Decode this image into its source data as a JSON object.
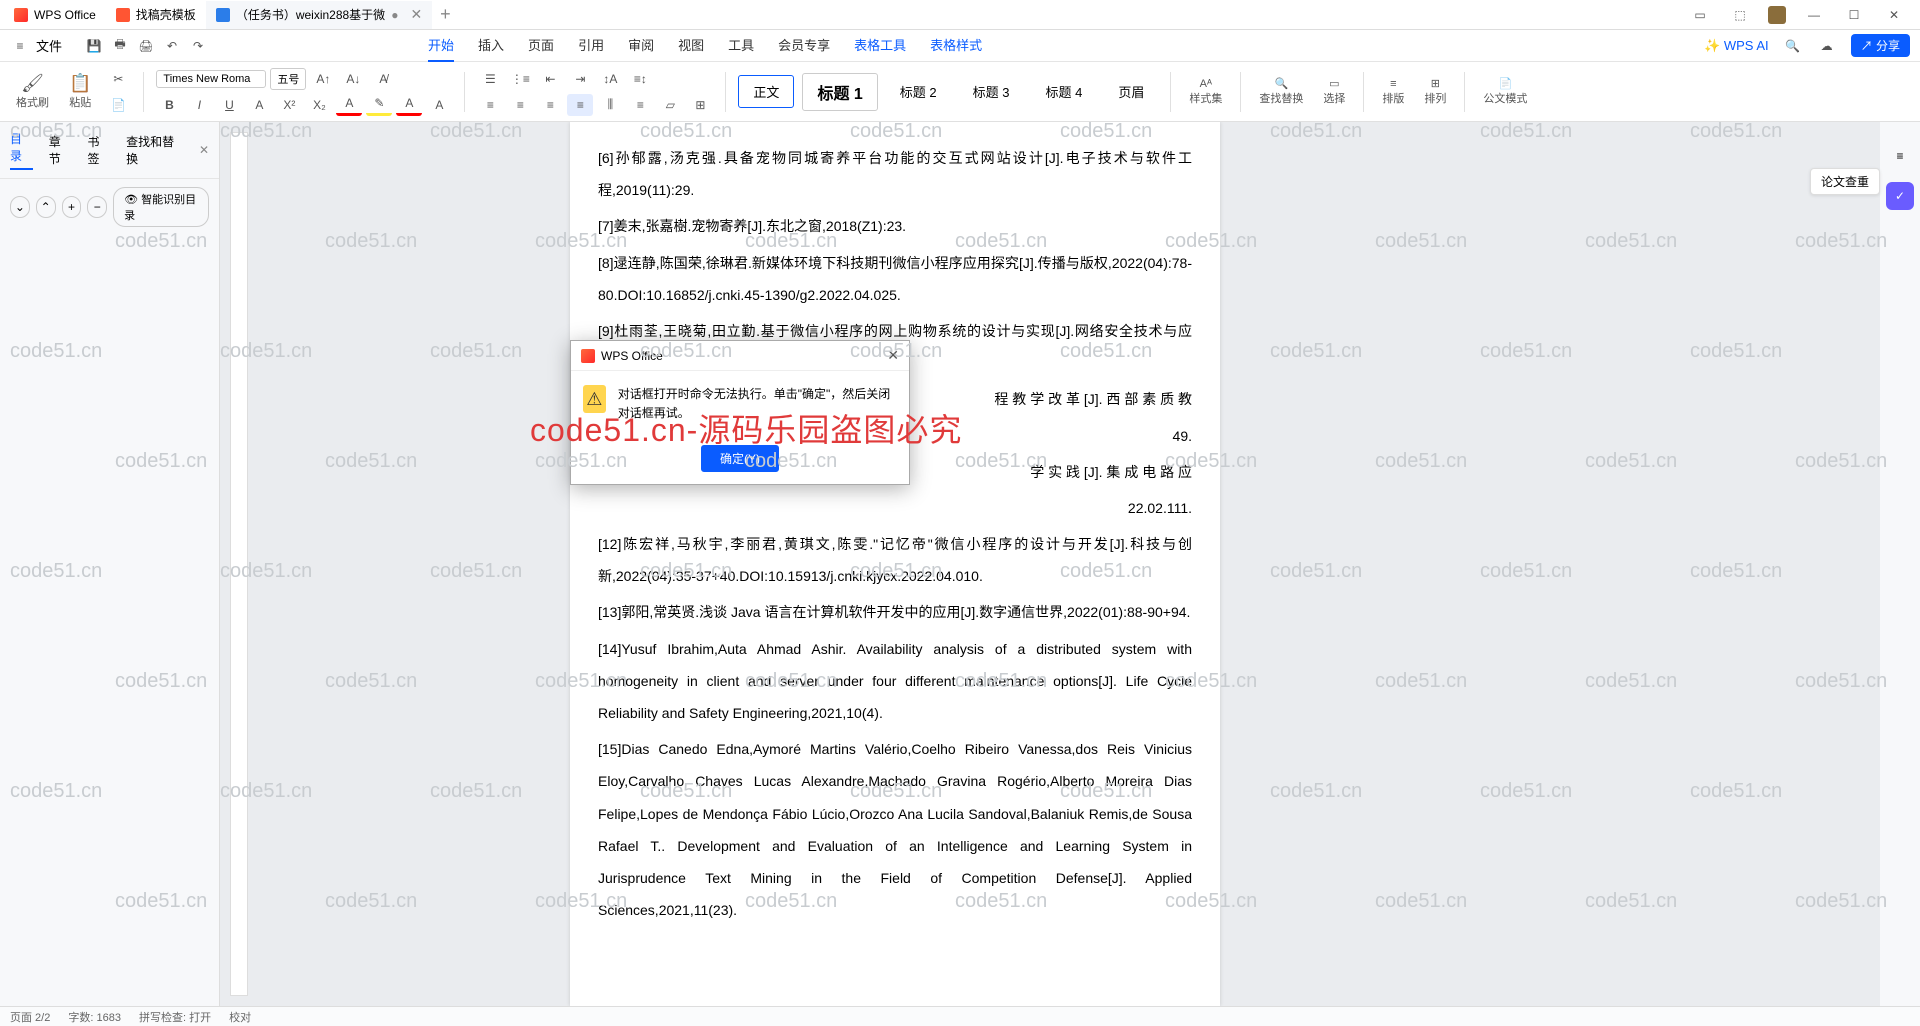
{
  "titlebar": {
    "tabs": [
      {
        "icon": "wps",
        "label": "WPS Office"
      },
      {
        "icon": "tpl",
        "label": "找稿壳模板"
      },
      {
        "icon": "doc",
        "label": "（任务书）weixin288基于微",
        "dirty": true,
        "active": true
      }
    ]
  },
  "window_controls": {
    "min": "—",
    "max": "☐",
    "close": "✕"
  },
  "menurow": {
    "file_label": "文件",
    "tabs": [
      "开始",
      "插入",
      "页面",
      "引用",
      "审阅",
      "视图",
      "工具",
      "会员专享"
    ],
    "table_tabs": [
      "表格工具",
      "表格样式"
    ],
    "ai_label": "WPS AI",
    "share_label": "分享"
  },
  "toolbar": {
    "format_brush": "格式刷",
    "paste": "粘贴",
    "font_name": "Times New Roma",
    "font_size": "五号",
    "styles": [
      "正文",
      "标题 1",
      "标题 2",
      "标题 3",
      "标题 4",
      "页眉"
    ],
    "style_set": "样式集",
    "find_replace": "查找替换",
    "select": "选择",
    "sort": "排版",
    "arrange": "排列",
    "official": "公文模式"
  },
  "sidenav": {
    "tabs": [
      "目录",
      "章节",
      "书签",
      "查找和替换"
    ],
    "smart_toc": "智能识别目录"
  },
  "rail": {
    "paper_check": "论文查重"
  },
  "dialog": {
    "title": "WPS Office",
    "message": "对话框打开时命令无法执行。单击\"确定\"，然后关闭对话框再试。",
    "ok": "确定(Y)"
  },
  "document": {
    "lines": [
      "[6]孙郁露,汤克强.具备宠物同城寄养平台功能的交互式网站设计[J].电子技术与软件工程,2019(11):29.",
      "[7]姜末,张嘉樹.宠物寄养[J].东北之窗,2018(Z1):23.",
      "[8]逯连静,陈国荣,徐琳君.新媒体环境下科技期刊微信小程序应用探究[J].传播与版权,2022(04):78-80.DOI:10.16852/j.cnki.45-1390/g2.2022.04.025.",
      "[9]杜雨荃,王晓菊,田立勤.基于微信小程序的网上购物系统的设计与实现[J].网络安全技术与应用,2022(04):62-64.",
      "程 教 学 改 革 [J]. 西 部 素 质 教",
      "49.",
      "学 实 践 [J]. 集 成 电 路 应",
      "22.02.111.",
      "[12]陈宏祥,马秋宇,李丽君,黄琪文,陈雯.\"记忆帝\"微信小程序的设计与开发[J].科技与创新,2022(04):35-37+40.DOI:10.15913/j.cnki.kjycx.2022.04.010.",
      "[13]郭阳,常英贤.浅谈 Java 语言在计算机软件开发中的应用[J].数字通信世界,2022(01):88-90+94.",
      "[14]Yusuf Ibrahim,Auta Ahmad Ashir. Availability analysis of a distributed system with homogeneity in client and server under four different maintenance options[J]. Life Cycle Reliability and Safety Engineering,2021,10(4).",
      "[15]Dias Canedo Edna,Aymoré Martins Valério,Coelho Ribeiro Vanessa,dos Reis Vinicius Eloy,Carvalho Chaves Lucas Alexandre,Machado Gravina Rogério,Alberto Moreira Dias Felipe,Lopes de Mendonça Fábio Lúcio,Orozco Ana Lucila Sandoval,Balaniuk Remis,de Sousa Rafael T.. Development and Evaluation of an Intelligence and Learning System in Jurisprudence Text Mining in the Field of Competition Defense[J]. Applied Sciences,2021,11(23)."
    ]
  },
  "statusbar": {
    "page": "页面 2/2",
    "words": "字数: 1683",
    "spell": "拼写检查: 打开",
    "proof": "校对"
  },
  "watermark_text": "code51.cn",
  "big_watermark": "code51.cn-源码乐园盗图必究"
}
